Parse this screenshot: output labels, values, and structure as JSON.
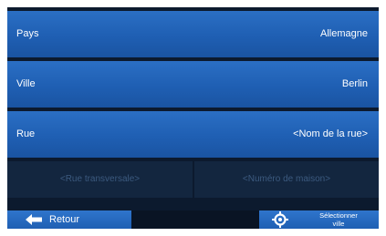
{
  "fields": {
    "pays": {
      "label": "Pays",
      "value": "Allemagne"
    },
    "ville": {
      "label": "Ville",
      "value": "Berlin"
    },
    "rue": {
      "label": "Rue",
      "value": "<Nom de la rue>"
    }
  },
  "disabled": {
    "cross_street": "<Rue transversale>",
    "house_number": "<Numéro de maison>"
  },
  "buttons": {
    "back": {
      "label": "Retour",
      "icon": "left-arrow-icon"
    },
    "select": {
      "label_line1": "Sélectionner",
      "label_line2": "ville",
      "icon": "crosshair-icon"
    }
  },
  "colors": {
    "row_blue": "#1f5fb3",
    "disabled_bg": "#13263f",
    "disabled_text": "#3c5a7f",
    "screen_bg": "#0c1a2e"
  }
}
